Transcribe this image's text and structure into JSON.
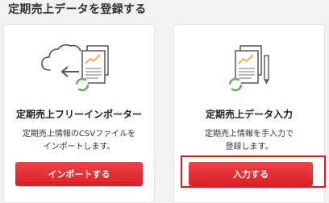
{
  "section": {
    "title": "定期売上データを登録する"
  },
  "cards": [
    {
      "title": "定期売上フリーインポーター",
      "desc_line1": "定期売上情報のCSVファイルを",
      "desc_line2": "インポートします。",
      "button_label": "インポートする",
      "icon": "cloud-import-document-icon"
    },
    {
      "title": "定期売上データ入力",
      "desc_line1": "定期売上情報を手入力で",
      "desc_line2": "登録します。",
      "button_label": "入力する",
      "icon": "document-pen-icon"
    }
  ],
  "colors": {
    "button": "#e0282e",
    "highlight": "#e8141c",
    "cycle_green": "#5cb85c",
    "chart_orange": "#f0a030"
  }
}
